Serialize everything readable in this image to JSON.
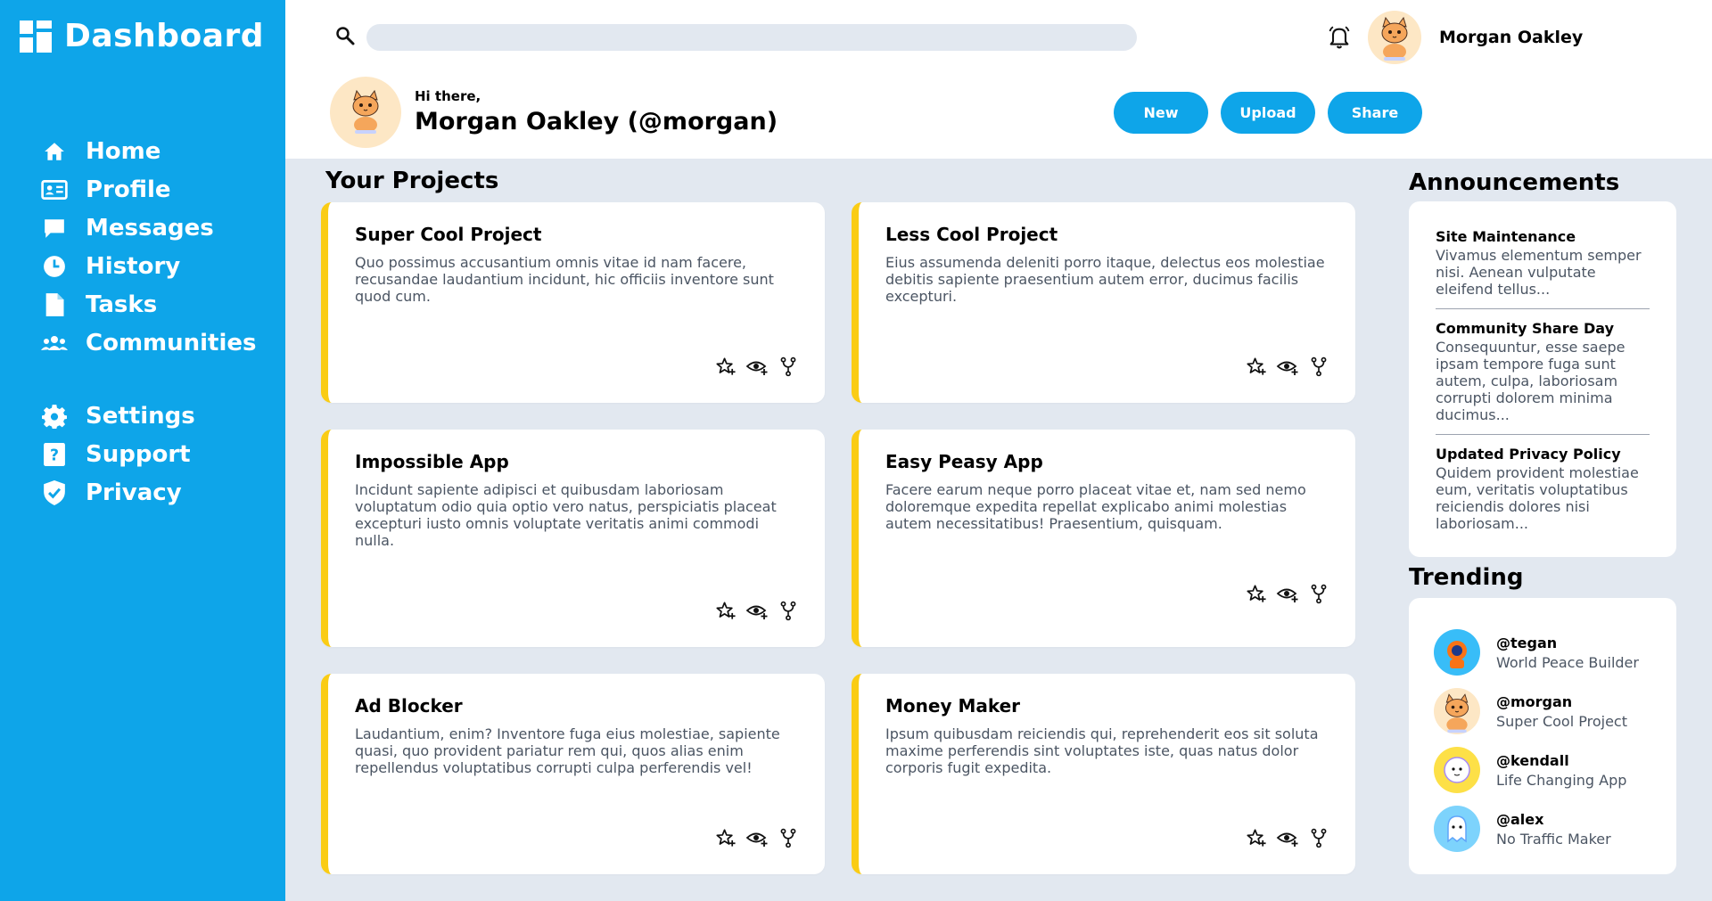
{
  "brand": {
    "title": "Dashboard"
  },
  "sidebar": {
    "main": [
      {
        "label": "Home",
        "icon": "home-icon"
      },
      {
        "label": "Profile",
        "icon": "id-card-icon"
      },
      {
        "label": "Messages",
        "icon": "message-icon"
      },
      {
        "label": "History",
        "icon": "clock-icon"
      },
      {
        "label": "Tasks",
        "icon": "document-icon"
      },
      {
        "label": "Communities",
        "icon": "users-icon"
      }
    ],
    "secondary": [
      {
        "label": "Settings",
        "icon": "gear-icon"
      },
      {
        "label": "Support",
        "icon": "help-icon"
      },
      {
        "label": "Privacy",
        "icon": "shield-icon"
      }
    ]
  },
  "header": {
    "search": {
      "value": "",
      "placeholder": ""
    },
    "username": "Morgan Oakley",
    "greeting": "Hi there,",
    "fullname": "Morgan Oakley (@morgan)",
    "buttons": {
      "new": "New",
      "upload": "Upload",
      "share": "Share"
    }
  },
  "projects": {
    "title": "Your Projects",
    "items": [
      {
        "title": "Super Cool Project",
        "description": "Quo possimus accusantium omnis vitae id nam facere, recusandae laudantium incidunt, hic officiis inventore sunt quod cum."
      },
      {
        "title": "Less Cool Project",
        "description": "Eius assumenda deleniti porro itaque, delectus eos molestiae debitis sapiente praesentium autem error, ducimus facilis excepturi."
      },
      {
        "title": "Impossible App",
        "description": "Incidunt sapiente adipisci et quibusdam laboriosam voluptatum odio quia optio vero natus, perspiciatis placeat excepturi iusto omnis voluptate veritatis animi commodi nulla."
      },
      {
        "title": "Easy Peasy App",
        "description": "Facere earum neque porro placeat vitae et, nam sed nemo doloremque expedita repellat explicabo animi molestias autem necessitatibus! Praesentium, quisquam."
      },
      {
        "title": "Ad Blocker",
        "description": "Laudantium, enim? Inventore fuga eius molestiae, sapiente quasi, quo provident pariatur rem qui, quos alias enim repellendus voluptatibus corrupti culpa perferendis vel!"
      },
      {
        "title": "Money Maker",
        "description": "Ipsum quibusdam reiciendis qui, reprehenderit eos sit soluta maxime perferendis sint voluptates iste, quas natus dolor corporis fugit expedita."
      }
    ],
    "action_icons": [
      "star-plus-icon",
      "eye-plus-icon",
      "fork-icon"
    ]
  },
  "announcements": {
    "title": "Announcements",
    "items": [
      {
        "title": "Site Maintenance",
        "body": "Vivamus elementum semper nisi. Aenean vulputate eleifend tellus..."
      },
      {
        "title": "Community Share Day",
        "body": "Consequuntur, esse saepe ipsam tempore fuga sunt autem, culpa, laboriosam corrupti dolorem minima ducimus..."
      },
      {
        "title": "Updated Privacy Policy",
        "body": "Quidem provident molestiae eum, veritatis voluptatibus reiciendis dolores nisi laboriosam..."
      }
    ]
  },
  "trending": {
    "title": "Trending",
    "items": [
      {
        "handle": "@tegan",
        "project": "World Peace Builder",
        "avatar_bg": "#38bdf8"
      },
      {
        "handle": "@morgan",
        "project": "Super Cool Project",
        "avatar_bg": "#fde7c5"
      },
      {
        "handle": "@kendall",
        "project": "Life Changing App",
        "avatar_bg": "#fde047"
      },
      {
        "handle": "@alex",
        "project": "No Traffic Maker",
        "avatar_bg": "#7dd3fc"
      }
    ]
  },
  "colors": {
    "primary": "#0ea5e9",
    "accent": "#facc15",
    "background": "#e2e8f0"
  }
}
